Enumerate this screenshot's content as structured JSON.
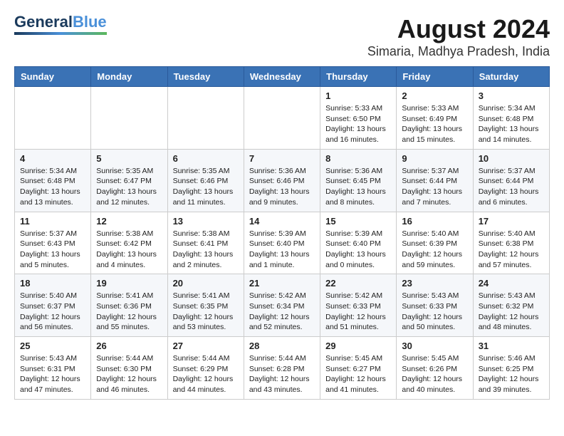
{
  "logo": {
    "line1": "General",
    "line2": "Blue"
  },
  "title": "August 2024",
  "subtitle": "Simaria, Madhya Pradesh, India",
  "days_of_week": [
    "Sunday",
    "Monday",
    "Tuesday",
    "Wednesday",
    "Thursday",
    "Friday",
    "Saturday"
  ],
  "weeks": [
    [
      {
        "day": null,
        "info": null
      },
      {
        "day": null,
        "info": null
      },
      {
        "day": null,
        "info": null
      },
      {
        "day": null,
        "info": null
      },
      {
        "day": "1",
        "info": "Sunrise: 5:33 AM\nSunset: 6:50 PM\nDaylight: 13 hours\nand 16 minutes."
      },
      {
        "day": "2",
        "info": "Sunrise: 5:33 AM\nSunset: 6:49 PM\nDaylight: 13 hours\nand 15 minutes."
      },
      {
        "day": "3",
        "info": "Sunrise: 5:34 AM\nSunset: 6:48 PM\nDaylight: 13 hours\nand 14 minutes."
      }
    ],
    [
      {
        "day": "4",
        "info": "Sunrise: 5:34 AM\nSunset: 6:48 PM\nDaylight: 13 hours\nand 13 minutes."
      },
      {
        "day": "5",
        "info": "Sunrise: 5:35 AM\nSunset: 6:47 PM\nDaylight: 13 hours\nand 12 minutes."
      },
      {
        "day": "6",
        "info": "Sunrise: 5:35 AM\nSunset: 6:46 PM\nDaylight: 13 hours\nand 11 minutes."
      },
      {
        "day": "7",
        "info": "Sunrise: 5:36 AM\nSunset: 6:46 PM\nDaylight: 13 hours\nand 9 minutes."
      },
      {
        "day": "8",
        "info": "Sunrise: 5:36 AM\nSunset: 6:45 PM\nDaylight: 13 hours\nand 8 minutes."
      },
      {
        "day": "9",
        "info": "Sunrise: 5:37 AM\nSunset: 6:44 PM\nDaylight: 13 hours\nand 7 minutes."
      },
      {
        "day": "10",
        "info": "Sunrise: 5:37 AM\nSunset: 6:44 PM\nDaylight: 13 hours\nand 6 minutes."
      }
    ],
    [
      {
        "day": "11",
        "info": "Sunrise: 5:37 AM\nSunset: 6:43 PM\nDaylight: 13 hours\nand 5 minutes."
      },
      {
        "day": "12",
        "info": "Sunrise: 5:38 AM\nSunset: 6:42 PM\nDaylight: 13 hours\nand 4 minutes."
      },
      {
        "day": "13",
        "info": "Sunrise: 5:38 AM\nSunset: 6:41 PM\nDaylight: 13 hours\nand 2 minutes."
      },
      {
        "day": "14",
        "info": "Sunrise: 5:39 AM\nSunset: 6:40 PM\nDaylight: 13 hours\nand 1 minute."
      },
      {
        "day": "15",
        "info": "Sunrise: 5:39 AM\nSunset: 6:40 PM\nDaylight: 13 hours\nand 0 minutes."
      },
      {
        "day": "16",
        "info": "Sunrise: 5:40 AM\nSunset: 6:39 PM\nDaylight: 12 hours\nand 59 minutes."
      },
      {
        "day": "17",
        "info": "Sunrise: 5:40 AM\nSunset: 6:38 PM\nDaylight: 12 hours\nand 57 minutes."
      }
    ],
    [
      {
        "day": "18",
        "info": "Sunrise: 5:40 AM\nSunset: 6:37 PM\nDaylight: 12 hours\nand 56 minutes."
      },
      {
        "day": "19",
        "info": "Sunrise: 5:41 AM\nSunset: 6:36 PM\nDaylight: 12 hours\nand 55 minutes."
      },
      {
        "day": "20",
        "info": "Sunrise: 5:41 AM\nSunset: 6:35 PM\nDaylight: 12 hours\nand 53 minutes."
      },
      {
        "day": "21",
        "info": "Sunrise: 5:42 AM\nSunset: 6:34 PM\nDaylight: 12 hours\nand 52 minutes."
      },
      {
        "day": "22",
        "info": "Sunrise: 5:42 AM\nSunset: 6:33 PM\nDaylight: 12 hours\nand 51 minutes."
      },
      {
        "day": "23",
        "info": "Sunrise: 5:43 AM\nSunset: 6:33 PM\nDaylight: 12 hours\nand 50 minutes."
      },
      {
        "day": "24",
        "info": "Sunrise: 5:43 AM\nSunset: 6:32 PM\nDaylight: 12 hours\nand 48 minutes."
      }
    ],
    [
      {
        "day": "25",
        "info": "Sunrise: 5:43 AM\nSunset: 6:31 PM\nDaylight: 12 hours\nand 47 minutes."
      },
      {
        "day": "26",
        "info": "Sunrise: 5:44 AM\nSunset: 6:30 PM\nDaylight: 12 hours\nand 46 minutes."
      },
      {
        "day": "27",
        "info": "Sunrise: 5:44 AM\nSunset: 6:29 PM\nDaylight: 12 hours\nand 44 minutes."
      },
      {
        "day": "28",
        "info": "Sunrise: 5:44 AM\nSunset: 6:28 PM\nDaylight: 12 hours\nand 43 minutes."
      },
      {
        "day": "29",
        "info": "Sunrise: 5:45 AM\nSunset: 6:27 PM\nDaylight: 12 hours\nand 41 minutes."
      },
      {
        "day": "30",
        "info": "Sunrise: 5:45 AM\nSunset: 6:26 PM\nDaylight: 12 hours\nand 40 minutes."
      },
      {
        "day": "31",
        "info": "Sunrise: 5:46 AM\nSunset: 6:25 PM\nDaylight: 12 hours\nand 39 minutes."
      }
    ]
  ]
}
